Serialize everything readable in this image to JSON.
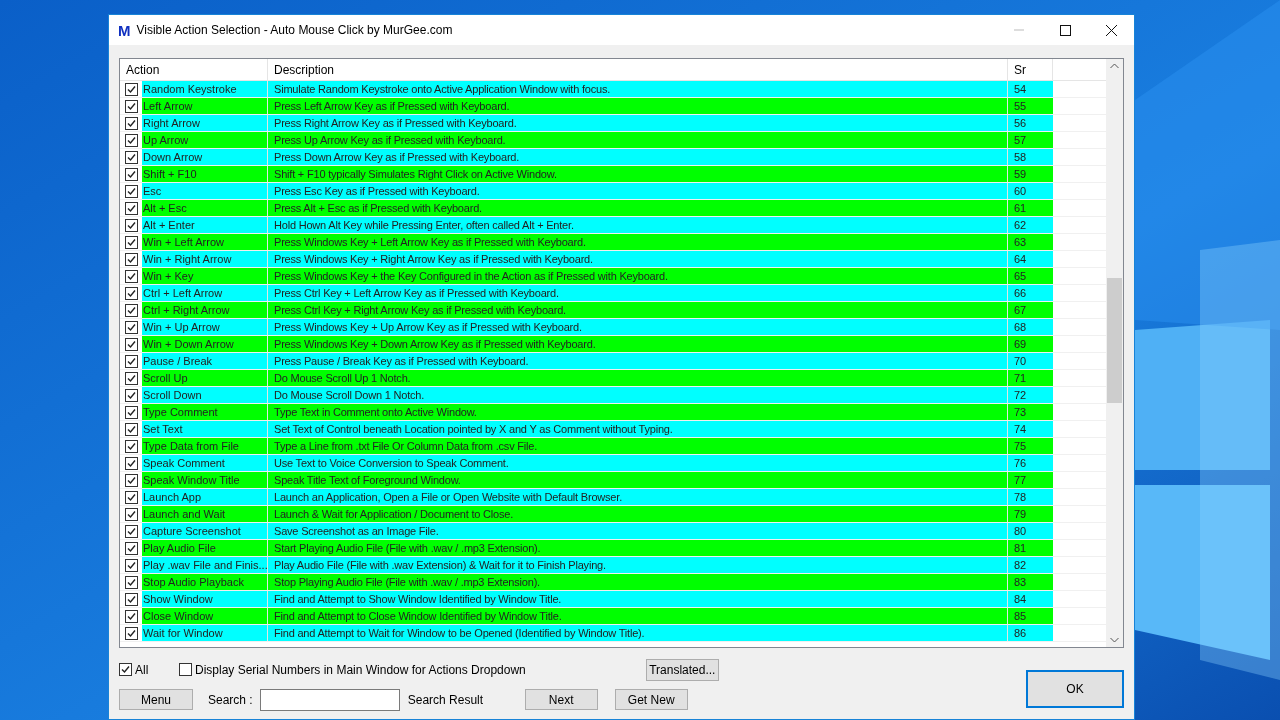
{
  "window": {
    "title": "Visible Action Selection - Auto Mouse Click by MurGee.com",
    "logo": "M"
  },
  "table": {
    "columns": [
      "Action",
      "Description",
      "Sr"
    ],
    "rows": [
      {
        "action": "Random Keystroke",
        "description": "Simulate Random Keystroke onto Active Application Window with focus.",
        "sr": "54",
        "checked": true,
        "color": "#00ffff"
      },
      {
        "action": "Left Arrow",
        "description": "Press Left Arrow Key as if Pressed with Keyboard.",
        "sr": "55",
        "checked": true,
        "color": "#00ff00"
      },
      {
        "action": "Right Arrow",
        "description": "Press Right Arrow Key as if Pressed with Keyboard.",
        "sr": "56",
        "checked": true,
        "color": "#00ffff"
      },
      {
        "action": "Up Arrow",
        "description": "Press Up Arrow Key as if Pressed with Keyboard.",
        "sr": "57",
        "checked": true,
        "color": "#00ff00"
      },
      {
        "action": "Down Arrow",
        "description": "Press Down Arrow Key as if Pressed with Keyboard.",
        "sr": "58",
        "checked": true,
        "color": "#00ffff"
      },
      {
        "action": "Shift + F10",
        "description": "Shift + F10 typically Simulates Right Click on Active Window.",
        "sr": "59",
        "checked": true,
        "color": "#00ff00"
      },
      {
        "action": "Esc",
        "description": "Press Esc Key as if Pressed with Keyboard.",
        "sr": "60",
        "checked": true,
        "color": "#00ffff"
      },
      {
        "action": "Alt + Esc",
        "description": "Press Alt + Esc as if Pressed with Keyboard.",
        "sr": "61",
        "checked": true,
        "color": "#00ff00"
      },
      {
        "action": "Alt + Enter",
        "description": "Hold Hown Alt Key while Pressing Enter, often called Alt + Enter.",
        "sr": "62",
        "checked": true,
        "color": "#00ffff"
      },
      {
        "action": "Win + Left Arrow",
        "description": "Press Windows Key + Left Arrow Key as if Pressed with Keyboard.",
        "sr": "63",
        "checked": true,
        "color": "#00ff00"
      },
      {
        "action": "Win + Right Arrow",
        "description": "Press Windows Key + Right Arrow Key as if Pressed with Keyboard.",
        "sr": "64",
        "checked": true,
        "color": "#00ffff"
      },
      {
        "action": "Win + Key",
        "description": "Press Windows Key + the Key Configured in the Action as if Pressed with Keyboard.",
        "sr": "65",
        "checked": true,
        "color": "#00ff00"
      },
      {
        "action": "Ctrl + Left Arrow",
        "description": "Press Ctrl Key + Left Arrow Key as if Pressed with Keyboard.",
        "sr": "66",
        "checked": true,
        "color": "#00ffff"
      },
      {
        "action": "Ctrl + Right Arrow",
        "description": "Press Ctrl Key + Right Arrow Key as if Pressed with Keyboard.",
        "sr": "67",
        "checked": true,
        "color": "#00ff00"
      },
      {
        "action": "Win + Up Arrow",
        "description": "Press Windows Key + Up Arrow Key as if Pressed with Keyboard.",
        "sr": "68",
        "checked": true,
        "color": "#00ffff"
      },
      {
        "action": "Win + Down Arrow",
        "description": "Press Windows Key + Down Arrow Key as if Pressed with Keyboard.",
        "sr": "69",
        "checked": true,
        "color": "#00ff00"
      },
      {
        "action": "Pause / Break",
        "description": "Press Pause / Break Key as if Pressed with Keyboard.",
        "sr": "70",
        "checked": true,
        "color": "#00ffff"
      },
      {
        "action": "Scroll Up",
        "description": "Do Mouse Scroll Up 1 Notch.",
        "sr": "71",
        "checked": true,
        "color": "#00ff00"
      },
      {
        "action": "Scroll Down",
        "description": "Do Mouse Scroll Down 1 Notch.",
        "sr": "72",
        "checked": true,
        "color": "#00ffff"
      },
      {
        "action": "Type Comment",
        "description": "Type Text in Comment onto Active Window.",
        "sr": "73",
        "checked": true,
        "color": "#00ff00"
      },
      {
        "action": "Set Text",
        "description": "Set Text of Control beneath Location pointed by X and Y as Comment without Typing.",
        "sr": "74",
        "checked": true,
        "color": "#00ffff"
      },
      {
        "action": "Type Data from File",
        "description": "Type a Line from .txt File Or Column Data from .csv File.",
        "sr": "75",
        "checked": true,
        "color": "#00ff00"
      },
      {
        "action": "Speak Comment",
        "description": "Use Text to Voice Conversion to Speak Comment.",
        "sr": "76",
        "checked": true,
        "color": "#00ffff"
      },
      {
        "action": "Speak Window Title",
        "description": "Speak Title Text of Foreground Window.",
        "sr": "77",
        "checked": true,
        "color": "#00ff00"
      },
      {
        "action": "Launch App",
        "description": "Launch an Application, Open a File or Open Website with Default Browser.",
        "sr": "78",
        "checked": true,
        "color": "#00ffff"
      },
      {
        "action": "Launch and Wait",
        "description": "Launch & Wait for Application / Document to Close.",
        "sr": "79",
        "checked": true,
        "color": "#00ff00"
      },
      {
        "action": "Capture Screenshot",
        "description": "Save Screenshot as an Image File.",
        "sr": "80",
        "checked": true,
        "color": "#00ffff"
      },
      {
        "action": "Play Audio File",
        "description": "Start Playing Audio File (File with .wav / .mp3 Extension).",
        "sr": "81",
        "checked": true,
        "color": "#00ff00"
      },
      {
        "action": "Play .wav File and Finis...",
        "description": "Play Audio File (File with .wav Extension) & Wait for it to Finish Playing.",
        "sr": "82",
        "checked": true,
        "color": "#00ffff"
      },
      {
        "action": "Stop Audio Playback",
        "description": "Stop Playing Audio File (File with .wav / .mp3 Extension).",
        "sr": "83",
        "checked": true,
        "color": "#00ff00"
      },
      {
        "action": "Show Window",
        "description": "Find and Attempt to Show Window Identified by Window Title.",
        "sr": "84",
        "checked": true,
        "color": "#00ffff"
      },
      {
        "action": "Close Window",
        "description": "Find and Attempt to Close Window Identified by Window Title.",
        "sr": "85",
        "checked": true,
        "color": "#00ff00"
      },
      {
        "action": "Wait for Window",
        "description": "Find and Attempt to Wait for Window to be Opened (Identified by Window Title).",
        "sr": "86",
        "checked": true,
        "color": "#00ffff"
      }
    ]
  },
  "options": [
    {
      "label": "All",
      "checked": true
    },
    {
      "label": "Display Serial Numbers in Main Window for Actions Dropdown",
      "checked": false
    }
  ],
  "buttons": {
    "translated": "Translated...",
    "menu": "Menu",
    "next": "Next",
    "get_new": "Get New",
    "ok": "OK"
  },
  "search": {
    "label": "Search :",
    "result": "Search Result"
  }
}
